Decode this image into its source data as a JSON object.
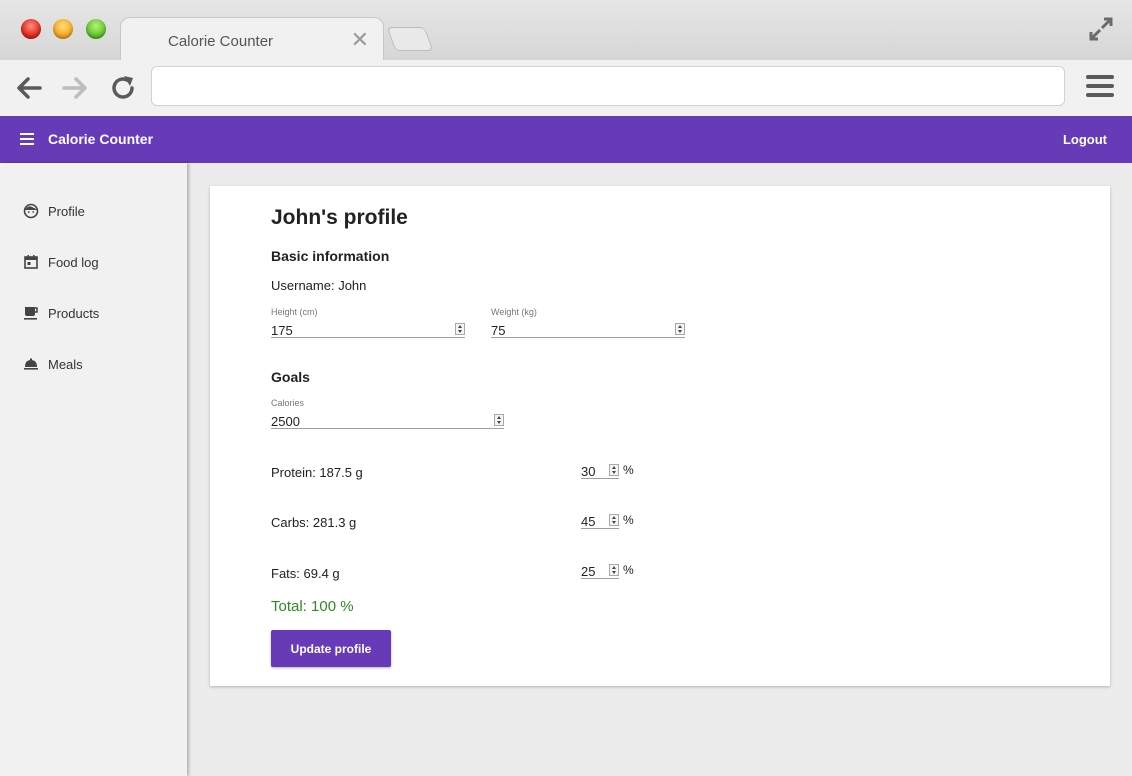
{
  "browser": {
    "tab_title": "Calorie Counter",
    "tab_close": "✕",
    "address": ""
  },
  "app": {
    "title": "Calorie Counter",
    "logout": "Logout",
    "accent_color": "#673ab7"
  },
  "sidebar": {
    "items": [
      {
        "label": "Profile",
        "icon": "face-icon"
      },
      {
        "label": "Food log",
        "icon": "calendar-icon"
      },
      {
        "label": "Products",
        "icon": "coffee-cup-icon"
      },
      {
        "label": "Meals",
        "icon": "cloche-icon"
      }
    ]
  },
  "profile": {
    "title": "John's profile",
    "basic_heading": "Basic information",
    "username_text": "Username: John",
    "height_label": "Height (cm)",
    "height_value": "175",
    "weight_label": "Weight (kg)",
    "weight_value": "75",
    "goals_heading": "Goals",
    "calories_label": "Calories",
    "calories_value": "2500",
    "macros": [
      {
        "text": "Protein: 187.5 g",
        "percent": "30"
      },
      {
        "text": "Carbs: 281.3 g",
        "percent": "45"
      },
      {
        "text": "Fats: 69.4 g",
        "percent": "25"
      }
    ],
    "percent_sign": "%",
    "total_text": "Total: 100 %",
    "total_color": "#2e8b22",
    "update_button": "Update profile"
  }
}
